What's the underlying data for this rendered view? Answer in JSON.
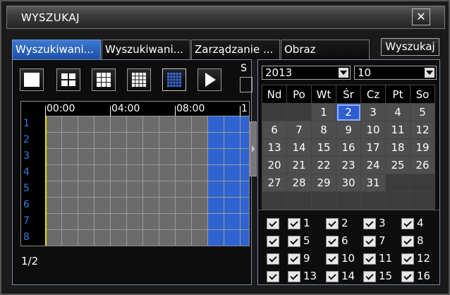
{
  "window": {
    "title": "WYSZUKAJ",
    "close_label": "✕"
  },
  "tabs": [
    {
      "label": "Wyszukiwani..."
    },
    {
      "label": "Wyszukiwani..."
    },
    {
      "label": "Zarządzanie ..."
    },
    {
      "label": "Obraz"
    }
  ],
  "search_button": "Wyszukaj",
  "view_buttons": [
    "1x1",
    "2x2",
    "3x3",
    "4x4",
    "5x5",
    "play"
  ],
  "side_label": "S",
  "timeline": {
    "time_labels": [
      "00:00",
      "04:00",
      "08:00",
      "1"
    ],
    "channels": [
      "1",
      "2",
      "3",
      "4",
      "5",
      "6",
      "7",
      "8"
    ],
    "page": "1/2"
  },
  "calendar": {
    "year": "2013",
    "month": "10",
    "weekdays": [
      "Nd",
      "Po",
      "Wt",
      "Śr",
      "Cz",
      "Pt",
      "So"
    ],
    "weeks": [
      [
        "",
        "",
        "1",
        "2",
        "3",
        "4",
        "5"
      ],
      [
        "6",
        "7",
        "8",
        "9",
        "10",
        "11",
        "12"
      ],
      [
        "13",
        "14",
        "15",
        "16",
        "17",
        "18",
        "19"
      ],
      [
        "20",
        "21",
        "22",
        "23",
        "24",
        "25",
        "26"
      ],
      [
        "27",
        "28",
        "29",
        "30",
        "31",
        "",
        ""
      ],
      [
        "",
        "",
        "",
        "",
        "",
        "",
        ""
      ]
    ],
    "selected_day": "2"
  },
  "channels_check": {
    "all_label": "",
    "items": [
      "1",
      "2",
      "3",
      "4",
      "5",
      "6",
      "7",
      "8",
      "9",
      "10",
      "11",
      "12",
      "13",
      "14",
      "15",
      "16"
    ]
  },
  "colors": {
    "accent": "#2f63d0",
    "record": "#2f63d0",
    "cursor": "#e8e000"
  }
}
